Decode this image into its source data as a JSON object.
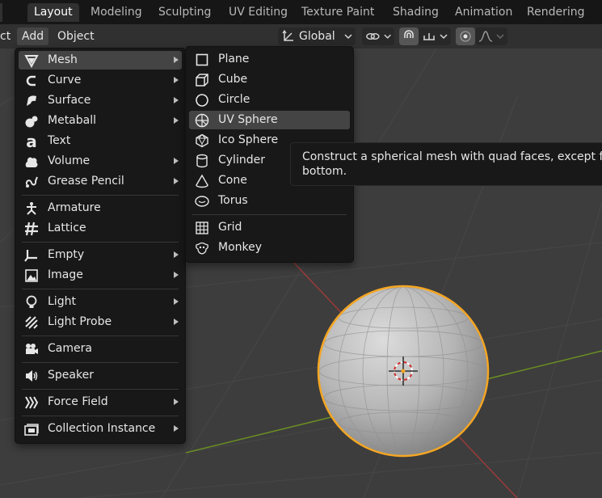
{
  "workspace_tabs": [
    "Layout",
    "Modeling",
    "Sculpting",
    "UV Editing",
    "Texture Paint",
    "Shading",
    "Animation",
    "Rendering"
  ],
  "active_tab": "Layout",
  "header": {
    "menus": [
      "ct",
      "Add",
      "Object"
    ],
    "transform_orientation": "Global"
  },
  "add_menu": {
    "items": [
      {
        "label": "Mesh",
        "icon": "mesh-icon",
        "submenu": true
      },
      {
        "label": "Curve",
        "icon": "curve-icon",
        "submenu": true
      },
      {
        "label": "Surface",
        "icon": "surface-icon",
        "submenu": true
      },
      {
        "label": "Metaball",
        "icon": "metaball-icon",
        "submenu": true
      },
      {
        "label": "Text",
        "icon": "text-icon",
        "submenu": false
      },
      {
        "label": "Volume",
        "icon": "volume-icon",
        "submenu": true
      },
      {
        "label": "Grease Pencil",
        "icon": "grease-pencil-icon",
        "submenu": true
      },
      {
        "label": "Armature",
        "icon": "armature-icon",
        "submenu": false
      },
      {
        "label": "Lattice",
        "icon": "lattice-icon",
        "submenu": false
      },
      {
        "label": "Empty",
        "icon": "empty-icon",
        "submenu": true
      },
      {
        "label": "Image",
        "icon": "image-icon",
        "submenu": true
      },
      {
        "label": "Light",
        "icon": "light-icon",
        "submenu": true
      },
      {
        "label": "Light Probe",
        "icon": "light-probe-icon",
        "submenu": true
      },
      {
        "label": "Camera",
        "icon": "camera-icon",
        "submenu": false
      },
      {
        "label": "Speaker",
        "icon": "speaker-icon",
        "submenu": false
      },
      {
        "label": "Force Field",
        "icon": "force-field-icon",
        "submenu": true
      },
      {
        "label": "Collection Instance",
        "icon": "collection-instance-icon",
        "submenu": true
      }
    ]
  },
  "mesh_menu": {
    "items": [
      {
        "label": "Plane",
        "icon": "plane-icon"
      },
      {
        "label": "Cube",
        "icon": "cube-icon"
      },
      {
        "label": "Circle",
        "icon": "circle-icon"
      },
      {
        "label": "UV Sphere",
        "icon": "uv-sphere-icon"
      },
      {
        "label": "Ico Sphere",
        "icon": "ico-sphere-icon"
      },
      {
        "label": "Cylinder",
        "icon": "cylinder-icon"
      },
      {
        "label": "Cone",
        "icon": "cone-icon"
      },
      {
        "label": "Torus",
        "icon": "torus-icon"
      },
      {
        "label": "Grid",
        "icon": "grid-icon"
      },
      {
        "label": "Monkey",
        "icon": "monkey-icon"
      }
    ]
  },
  "tooltip": {
    "line1": "Construct a spherical mesh with quad faces, except for t",
    "line2": "bottom."
  },
  "colors": {
    "viewport_bg": "#3d3d3d",
    "menu_bg": "#181818",
    "highlight": "#444444",
    "selection_outline": "#f5a623",
    "x_axis": "#9b3a3a",
    "y_axis": "#6b8e23"
  }
}
